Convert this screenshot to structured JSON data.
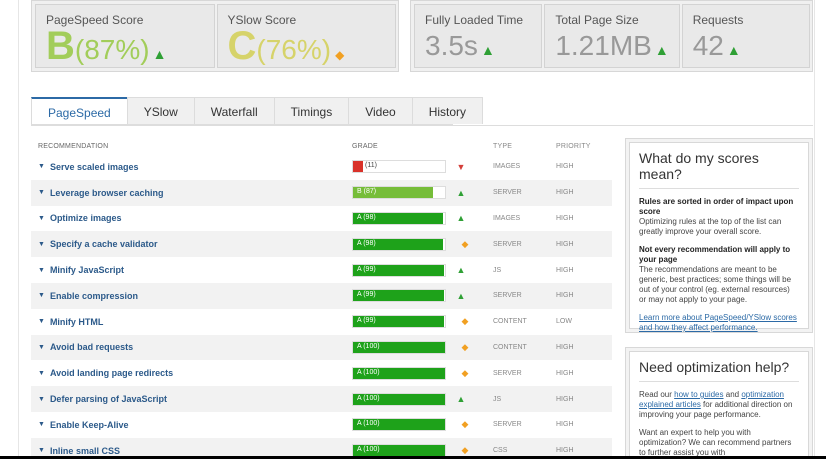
{
  "scores": {
    "pagespeed": {
      "label": "PageSpeed Score",
      "grade": "B",
      "value": "(87%)"
    },
    "yslow": {
      "label": "YSlow Score",
      "grade": "C",
      "value": "(76%)"
    }
  },
  "metrics": {
    "fully_loaded": {
      "label": "Fully Loaded Time",
      "value": "3.5s"
    },
    "page_size": {
      "label": "Total Page Size",
      "value": "1.21MB"
    },
    "requests": {
      "label": "Requests",
      "value": "42"
    }
  },
  "tabs": [
    "PageSpeed",
    "YSlow",
    "Waterfall",
    "Timings",
    "Video",
    "History"
  ],
  "table": {
    "headers": {
      "recommendation": "RECOMMENDATION",
      "grade": "GRADE",
      "type": "TYPE",
      "priority": "PRIORITY"
    },
    "rows": [
      {
        "name": "Serve scaled images",
        "grade": "(11)",
        "score": 11,
        "color": "#d9322a",
        "trend": "down",
        "type": "IMAGES",
        "priority": "HIGH"
      },
      {
        "name": "Leverage browser caching",
        "grade": "B (87)",
        "score": 87,
        "color": "#76bd39",
        "trend": "up",
        "type": "SERVER",
        "priority": "HIGH"
      },
      {
        "name": "Optimize images",
        "grade": "A (98)",
        "score": 98,
        "color": "#1ea21a",
        "trend": "up",
        "type": "IMAGES",
        "priority": "HIGH"
      },
      {
        "name": "Specify a cache validator",
        "grade": "A (98)",
        "score": 98,
        "color": "#1ea21a",
        "trend": "diamond",
        "type": "SERVER",
        "priority": "HIGH"
      },
      {
        "name": "Minify JavaScript",
        "grade": "A (99)",
        "score": 99,
        "color": "#1ea21a",
        "trend": "up",
        "type": "JS",
        "priority": "HIGH"
      },
      {
        "name": "Enable compression",
        "grade": "A (99)",
        "score": 99,
        "color": "#1ea21a",
        "trend": "up",
        "type": "SERVER",
        "priority": "HIGH"
      },
      {
        "name": "Minify HTML",
        "grade": "A (99)",
        "score": 99,
        "color": "#1ea21a",
        "trend": "diamond",
        "type": "CONTENT",
        "priority": "LOW"
      },
      {
        "name": "Avoid bad requests",
        "grade": "A (100)",
        "score": 100,
        "color": "#1ea21a",
        "trend": "diamond",
        "type": "CONTENT",
        "priority": "HIGH"
      },
      {
        "name": "Avoid landing page redirects",
        "grade": "A (100)",
        "score": 100,
        "color": "#1ea21a",
        "trend": "diamond",
        "type": "SERVER",
        "priority": "HIGH"
      },
      {
        "name": "Defer parsing of JavaScript",
        "grade": "A (100)",
        "score": 100,
        "color": "#1ea21a",
        "trend": "up",
        "type": "JS",
        "priority": "HIGH"
      },
      {
        "name": "Enable Keep-Alive",
        "grade": "A (100)",
        "score": 100,
        "color": "#1ea21a",
        "trend": "diamond",
        "type": "SERVER",
        "priority": "HIGH"
      },
      {
        "name": "Inline small CSS",
        "grade": "A (100)",
        "score": 100,
        "color": "#1ea21a",
        "trend": "diamond",
        "type": "CSS",
        "priority": "HIGH"
      }
    ]
  },
  "sidebar": {
    "scores_box": {
      "title": "What do my scores mean?",
      "h1": "Rules are sorted in order of impact upon score",
      "p1": "Optimizing rules at the top of the list can greatly improve your overall score.",
      "h2": "Not every recommendation will apply to your page",
      "p2": "The recommendations are meant to be generic, best practices; some things will be out of your control (eg. external resources) or may not apply to your page.",
      "link": "Learn more about PageSpeed/YSlow scores and how they affect performance."
    },
    "help_box": {
      "title": "Need optimization help?",
      "p1_a": "Read our ",
      "link1": "how to guides",
      "p1_b": " and ",
      "link2": "optimization explained articles",
      "p1_c": " for additional direction on improving your page performance.",
      "p2": "Want an expert to help you with optimization? We can recommend partners to further assist you with"
    }
  }
}
